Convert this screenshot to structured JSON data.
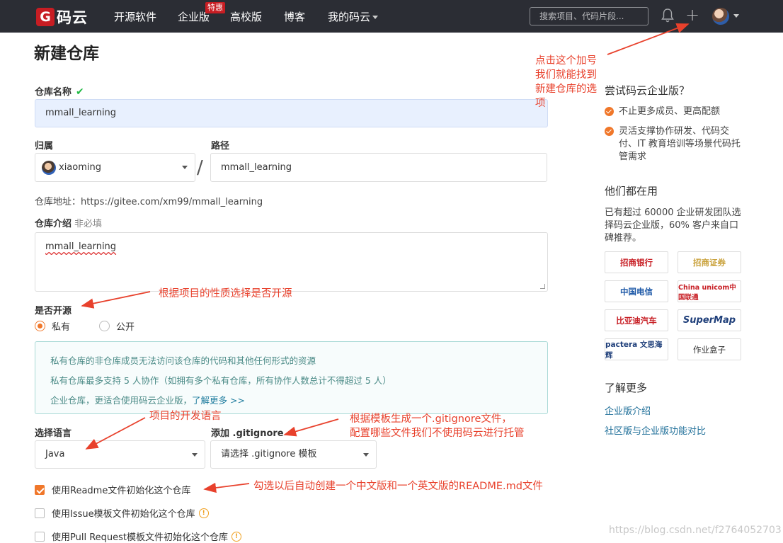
{
  "header": {
    "logo_mark": "G",
    "logo_text": "码云",
    "nav": [
      "开源软件",
      "企业版",
      "高校版",
      "博客",
      "我的码云"
    ],
    "badge": "特惠",
    "search_placeholder": "搜索项目、代码片段...",
    "plus": "+"
  },
  "page_title": "新建仓库",
  "form": {
    "name_label": "仓库名称",
    "name_check": "✔",
    "name_value": "mmall_learning",
    "owner_label": "归属",
    "owner_value": "xiaoming",
    "path_label": "路径",
    "path_value": "mmall_learning",
    "slash": "/",
    "repo_address": "仓库地址：https://gitee.com/xm99/mmall_learning",
    "desc_label": "仓库介绍",
    "desc_optional": "非必填",
    "desc_value": "mmall_learning",
    "open_label": "是否开源",
    "private_label": "私有",
    "public_label": "公开",
    "info_line1": "私有仓库的非仓库成员无法访问该仓库的代码和其他任何形式的资源",
    "info_line2": "私有仓库最多支持 5 人协作（如拥有多个私有仓库，所有协作人数总计不得超过 5 人）",
    "info_line3": "企业仓库，更适合使用码云企业版，",
    "info_more": "了解更多 >>",
    "lang_label": "选择语言",
    "lang_value": "Java",
    "gitignore_label": "添加 .gitignore",
    "gitignore_value": "请选择 .gitignore 模板",
    "cb_readme": "使用Readme文件初始化这个仓库",
    "cb_issue": "使用Issue模板文件初始化这个仓库",
    "cb_pr": "使用Pull Request模板文件初始化这个仓库",
    "info_icon": "!"
  },
  "annotations": {
    "plus_note": [
      "点击这个加号",
      "我们就能找到",
      "新建仓库的选",
      "项"
    ],
    "open_note": "根据项目的性质选择是否开源",
    "lang_note": "项目的开发语言",
    "gitignore_note": [
      "根据模板生成一个.gitignore文件，",
      "配置哪些文件我们不使用码云进行托管"
    ],
    "readme_note": "勾选以后自动创建一个中文版和一个英文版的README.md文件"
  },
  "sidebar": {
    "try_title": "尝试码云企业版？",
    "features": [
      "不止更多成员、更高配额",
      "灵活支撑协作研发、代码交付、IT 教育培训等场景代码托管需求"
    ],
    "using_title": "他们都在用",
    "using_text": "已有超过 60000 企业研发团队选择码云企业版，60% 客户来自口碑推荐。",
    "partners": [
      "招商银行",
      "招商证券",
      "中国电信",
      "China unicom中国联通",
      "比亚迪汽车",
      "SuperMap",
      "pactera 文思海辉",
      "作业盒子"
    ],
    "more_title": "了解更多",
    "links": [
      "企业版介绍",
      "社区版与企业版功能对比"
    ]
  },
  "watermark": "https://blog.csdn.net/f2764052703",
  "colors": {
    "header_bg": "#2b2d34",
    "brand_red": "#c71d23",
    "accent_orange": "#f0772a",
    "annotation_red": "#e8412c"
  }
}
